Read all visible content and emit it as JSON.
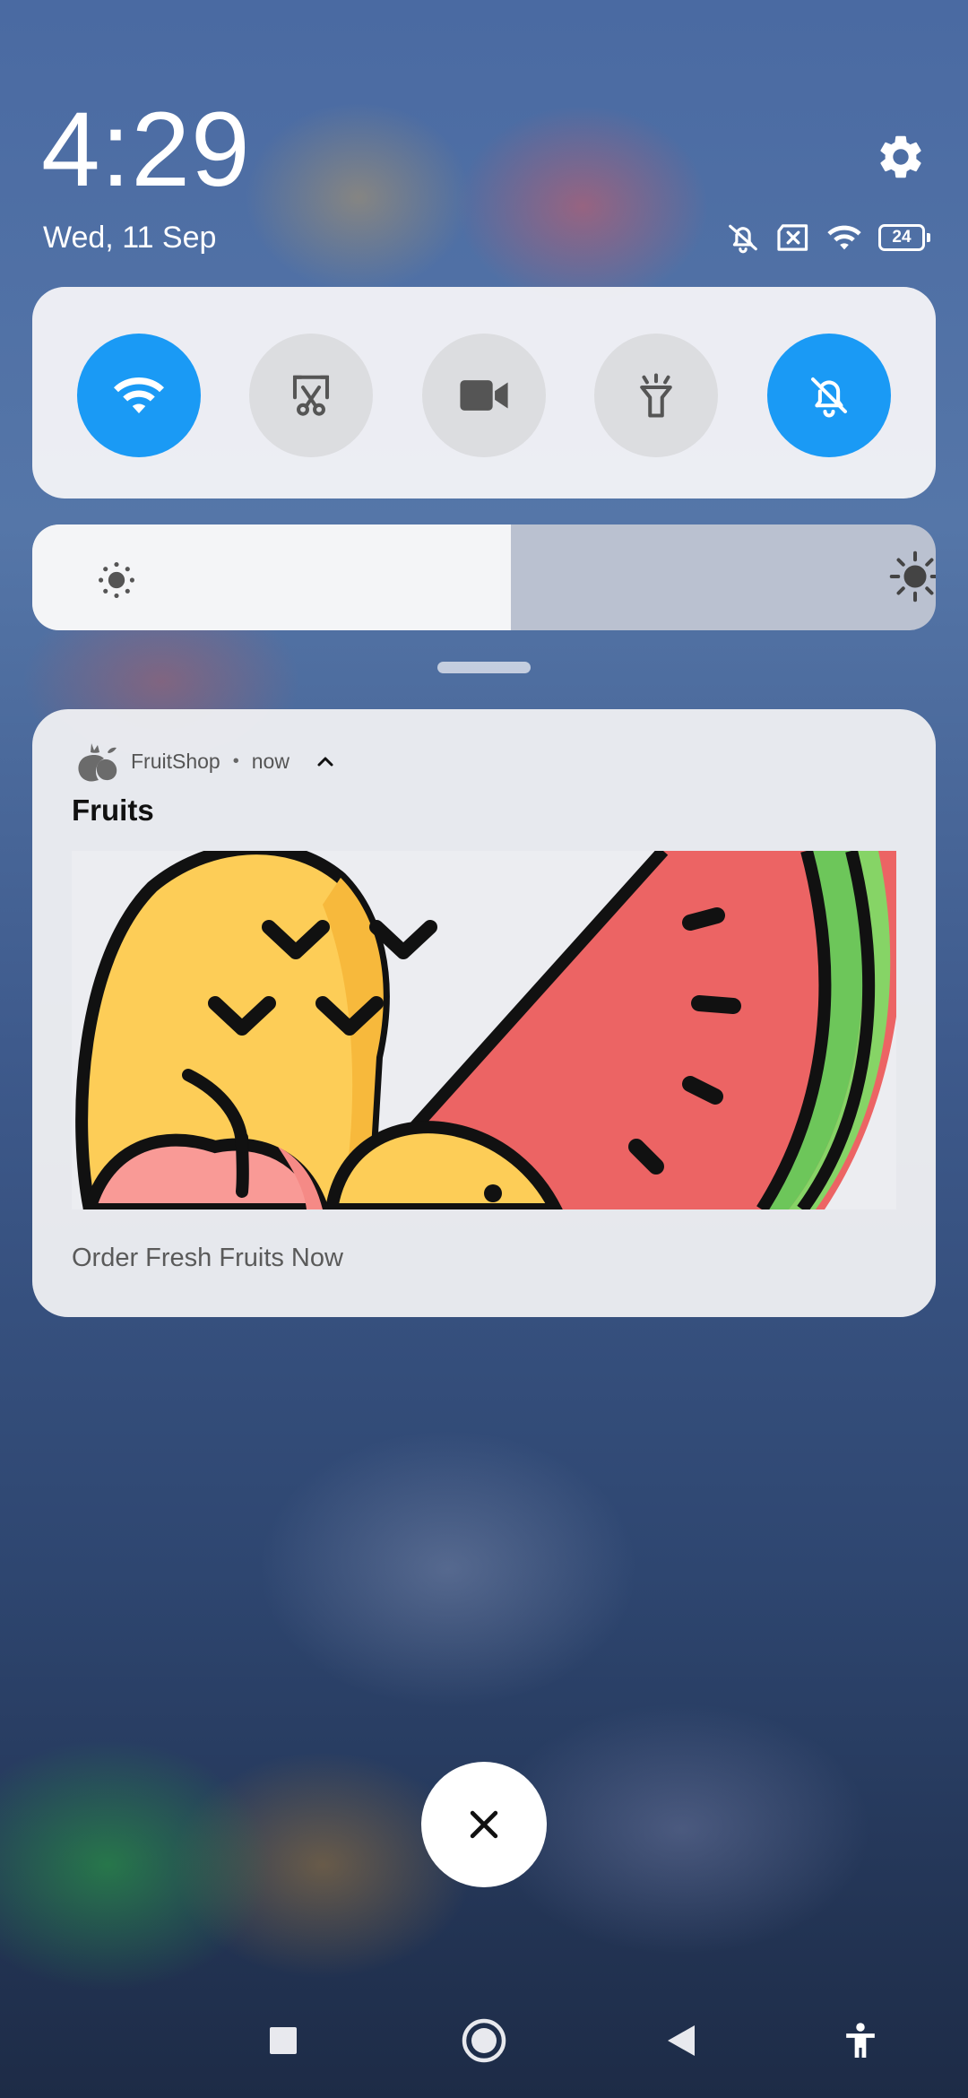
{
  "status": {
    "time": "4:29",
    "date": "Wed, 11 Sep",
    "battery": "24",
    "icons": [
      "silent-icon",
      "no-sim-icon",
      "wifi-icon",
      "battery-icon"
    ]
  },
  "quick_settings": {
    "toggles": [
      {
        "name": "wifi",
        "icon": "wifi-icon",
        "on": true
      },
      {
        "name": "screenshot",
        "icon": "screenshot-icon",
        "on": false
      },
      {
        "name": "screen-record",
        "icon": "video-camera-icon",
        "on": false
      },
      {
        "name": "flashlight",
        "icon": "flashlight-icon",
        "on": false
      },
      {
        "name": "mute",
        "icon": "bell-off-icon",
        "on": true
      }
    ],
    "brightness_level": 0.53,
    "accent_color": "#1a9af5"
  },
  "notification": {
    "app_name": "FruitShop",
    "separator": "•",
    "time": "now",
    "title": "Fruits",
    "text": "Order Fresh Fruits Now",
    "image": "fruits-illustration"
  },
  "navigation": {
    "items": [
      "recents-icon",
      "home-icon",
      "back-icon",
      "accessibility-icon"
    ]
  }
}
